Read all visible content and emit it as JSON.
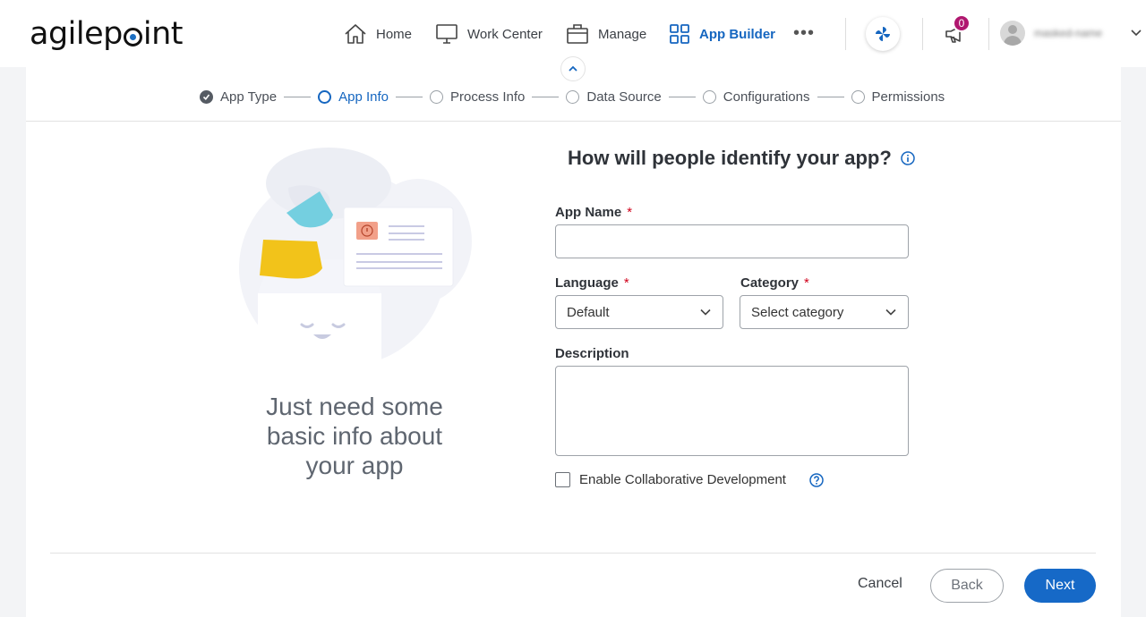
{
  "header": {
    "logo_text_a": "agilep",
    "logo_text_b": "int",
    "nav": [
      {
        "label": "Home",
        "icon": "home-icon"
      },
      {
        "label": "Work Center",
        "icon": "monitor-icon"
      },
      {
        "label": "Manage",
        "icon": "briefcase-icon"
      },
      {
        "label": "App Builder",
        "icon": "grid-icon",
        "active": true
      }
    ],
    "more_label": "•••",
    "notification_count": "0",
    "username": "masked-name"
  },
  "stepper": {
    "steps": [
      {
        "label": "App Type",
        "state": "done"
      },
      {
        "label": "App Info",
        "state": "current"
      },
      {
        "label": "Process Info",
        "state": "todo"
      },
      {
        "label": "Data Source",
        "state": "todo"
      },
      {
        "label": "Configurations",
        "state": "todo"
      },
      {
        "label": "Permissions",
        "state": "todo"
      }
    ]
  },
  "illustration": {
    "tagline": "Just need some basic info about your app"
  },
  "form": {
    "title": "How will people identify your app?",
    "app_name_label": "App Name",
    "app_name_value": "",
    "required_mark": "*",
    "language_label": "Language",
    "language_value": "Default",
    "category_label": "Category",
    "category_value": "Select category",
    "description_label": "Description",
    "description_value": "",
    "collab_label": "Enable Collaborative Development",
    "collab_checked": false
  },
  "footer": {
    "cancel_label": "Cancel",
    "back_label": "Back",
    "next_label": "Next"
  },
  "colors": {
    "accent": "#1566c0",
    "required": "#d0021b",
    "badge": "#b0176f"
  }
}
